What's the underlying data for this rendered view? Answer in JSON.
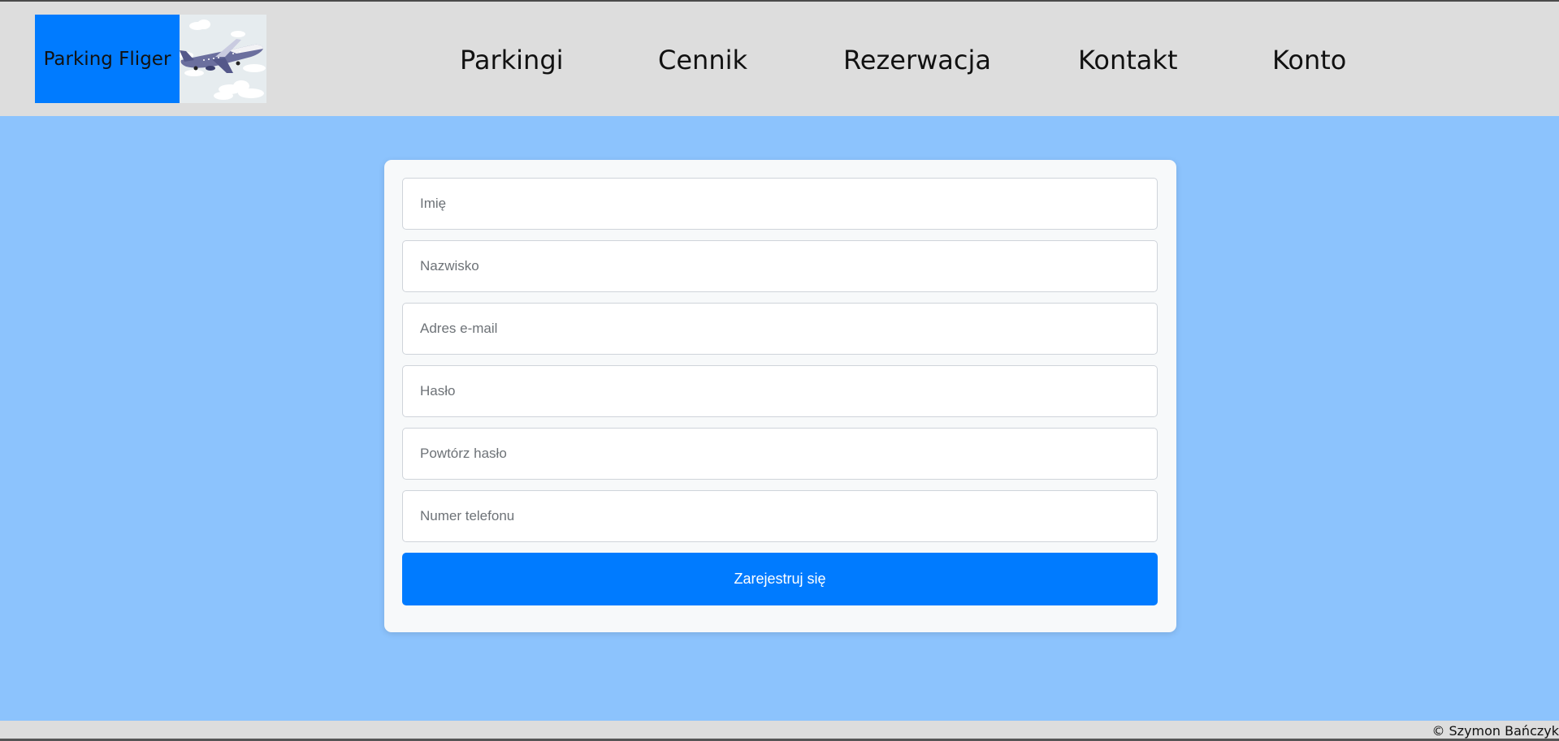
{
  "brand": {
    "name": "Parking Fliger",
    "logo_icon": "airplane-icon"
  },
  "nav": {
    "items": [
      {
        "label": "Parkingi"
      },
      {
        "label": "Cennik"
      },
      {
        "label": "Rezerwacja"
      },
      {
        "label": "Kontakt"
      },
      {
        "label": "Konto"
      }
    ]
  },
  "form": {
    "fields": [
      {
        "placeholder": "Imię",
        "value": ""
      },
      {
        "placeholder": "Nazwisko",
        "value": ""
      },
      {
        "placeholder": "Adres e-mail",
        "value": ""
      },
      {
        "placeholder": "Hasło",
        "value": ""
      },
      {
        "placeholder": "Powtórz hasło",
        "value": ""
      },
      {
        "placeholder": "Numer telefonu",
        "value": ""
      }
    ],
    "submit_label": "Zarejestruj się"
  },
  "footer": {
    "text": "© Szymon Bańczyk"
  },
  "colors": {
    "header_bg": "#dddddd",
    "page_bg": "#8cc3fd",
    "accent": "#007bff",
    "card_bg": "#f7f9fa"
  }
}
